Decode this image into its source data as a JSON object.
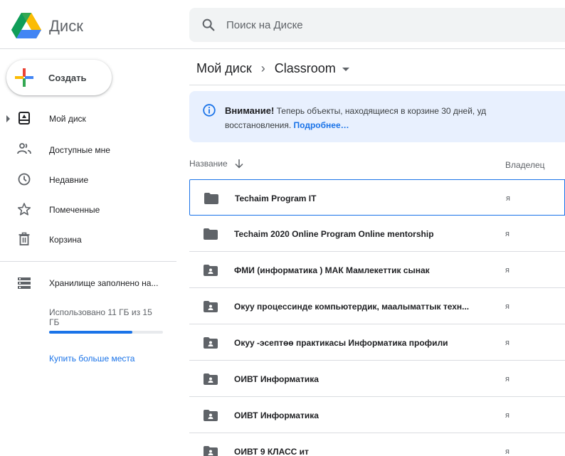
{
  "app": {
    "title": "Диск",
    "search_placeholder": "Поиск на Диске"
  },
  "sidebar": {
    "create_label": "Создать",
    "items": [
      {
        "label": "Мой диск",
        "icon": "my-drive-icon"
      },
      {
        "label": "Доступные мне",
        "icon": "shared-with-me-icon"
      },
      {
        "label": "Недавние",
        "icon": "recent-clock-icon"
      },
      {
        "label": "Помеченные",
        "icon": "star-icon"
      },
      {
        "label": "Корзина",
        "icon": "trash-icon"
      }
    ],
    "storage": {
      "title": "Хранилище заполнено на...",
      "used_text": "Использовано 11 ГБ из 15 ГБ",
      "fraction": 0.73,
      "buy_label": "Купить больше места"
    }
  },
  "breadcrumb": {
    "root": "Мой диск",
    "current": "Classroom"
  },
  "banner": {
    "bold": "Внимание!",
    "text": " Теперь объекты, находящиеся в корзине 30 дней, уд",
    "text2": "восстановления. ",
    "link": "Подробнее…"
  },
  "table": {
    "columns": {
      "name": "Название",
      "owner": "Владелец"
    },
    "rows": [
      {
        "name": "Techaim Program IT",
        "owner": "я",
        "shared": false
      },
      {
        "name": "Techaim 2020 Online Program Online mentorship",
        "owner": "я",
        "shared": false
      },
      {
        "name": "ФМИ (информатика ) МАК Мамлекеттик сынак",
        "owner": "я",
        "shared": true
      },
      {
        "name": "Окуу процессинде компьютердик, маалыматтык техн...",
        "owner": "я",
        "shared": true
      },
      {
        "name": "Окуу -эсептөө практикасы Информатика профили",
        "owner": "я",
        "shared": true
      },
      {
        "name": "ОИВТ Информатика",
        "owner": "я",
        "shared": true
      },
      {
        "name": "ОИВТ Информатика",
        "owner": "я",
        "shared": true
      },
      {
        "name": "ОИВТ 9 КЛАСС ит",
        "owner": "я",
        "shared": true
      }
    ]
  },
  "colors": {
    "accent": "#1a73e8",
    "folder": "#5f6368",
    "banner_bg": "#e8f0fe"
  }
}
